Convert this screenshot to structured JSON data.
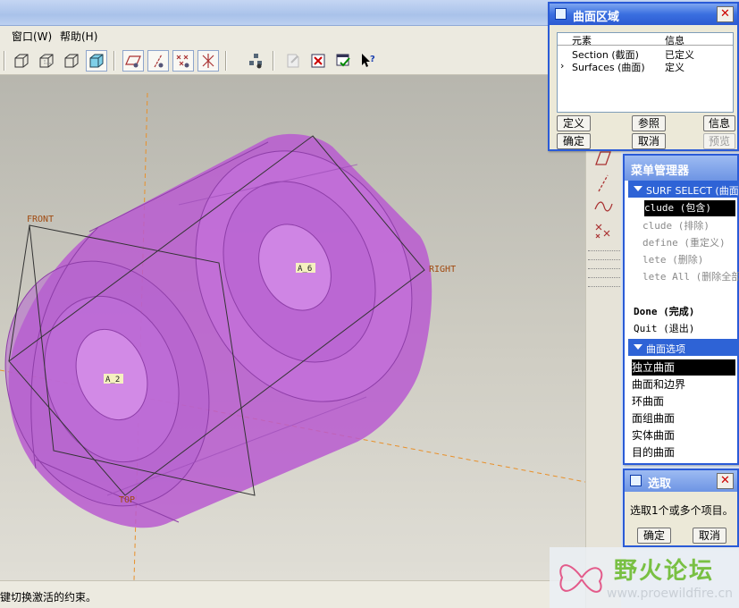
{
  "menubar": {
    "window": "窗口(W)",
    "help": "帮助(H)"
  },
  "toolbar": {
    "icons": [
      "view-wireframe-icon",
      "view-hidden-line-icon",
      "view-no-hidden-icon",
      "view-shaded-icon",
      "datum-plane-display-icon",
      "datum-axis-display-icon",
      "datum-point-display-icon",
      "csys-display-icon",
      "model-tree-icon",
      "redo-feature-icon",
      "close-window-icon",
      "regenerate-icon",
      "context-help-icon"
    ]
  },
  "viewport": {
    "datums": {
      "front": "FRONT",
      "right": "RIGHT",
      "top": "TOP",
      "axis_a6": "A_6",
      "axis_a2": "A_2"
    },
    "model_color": "#b85ad0",
    "datum_color": "#e8902a"
  },
  "status": {
    "message": "键切换激活的约束。"
  },
  "region_dialog": {
    "title": "曲面区域",
    "columns": [
      "元素",
      "信息"
    ],
    "rows": [
      {
        "element": "Section (截面)",
        "info": "已定义",
        "current": false
      },
      {
        "element": "Surfaces (曲面)",
        "info": "定义",
        "current": true
      }
    ],
    "buttons": {
      "define": "定义",
      "refs": "参照",
      "info": "信息",
      "ok": "确定",
      "cancel": "取消",
      "preview": "预览"
    }
  },
  "menu_manager": {
    "title": "菜单管理器",
    "section1": "SURF SELECT (曲面",
    "section1_items": [
      "clude (包含)",
      "clude (排除)",
      "define (重定义)",
      "lete (删除)",
      "lete All (删除全部"
    ],
    "done": "Done (完成)",
    "quit": "Quit (退出)",
    "section2": "曲面选项",
    "section2_items": [
      "独立曲面",
      "曲面和边界",
      "环曲面",
      "面组曲面",
      "实体曲面",
      "目的曲面"
    ]
  },
  "select_dialog": {
    "title": "选取",
    "prompt": "选取1个或多个项目。",
    "ok": "确定",
    "cancel": "取消"
  },
  "watermark": {
    "name": "野火论坛",
    "url": "www.proewildfire.cn"
  },
  "colors": {
    "accent": "#2e63d6",
    "title_bar": "#3a6fe0",
    "panel": "#ece9d8"
  }
}
